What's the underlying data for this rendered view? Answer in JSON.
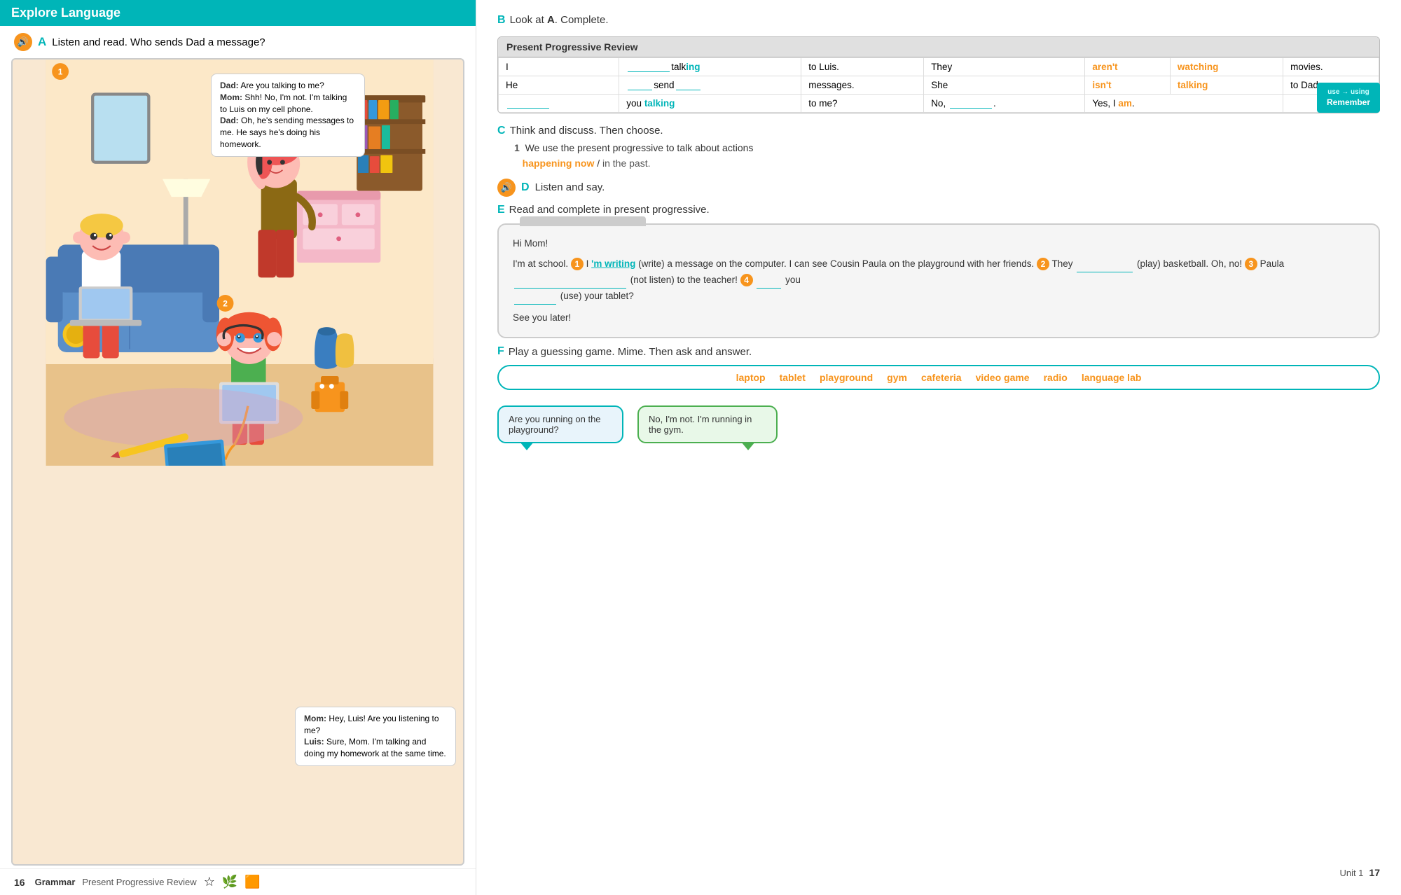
{
  "left": {
    "header": "Explore Language",
    "section_a": {
      "label": "A",
      "instruction": "Listen and read. Who sends Dad a message?"
    },
    "badge_1": "1",
    "badge_2": "2",
    "dialogues": [
      {
        "speaker": "Dad:",
        "text": "Are you talking to me?"
      },
      {
        "speaker": "Mom:",
        "text": "Shh! No, I'm not. I'm talking to Luis on my cell phone."
      },
      {
        "speaker": "Dad:",
        "text": "Oh, he's sending messages to me. He says he's doing his homework."
      }
    ],
    "dialogues2": [
      {
        "speaker": "Mom:",
        "text": "Hey, Luis! Are you listening to me?"
      },
      {
        "speaker": "Luis:",
        "text": "Sure, Mom. I'm talking and doing my homework at the same time."
      }
    ],
    "bottom": {
      "page_num": "16",
      "label": "Grammar",
      "sublabel": "Present Progressive Review",
      "icons": [
        "☆",
        "🌿",
        "⬛"
      ]
    }
  },
  "right": {
    "section_b": {
      "label": "B",
      "instruction": "Look at A. Complete."
    },
    "table": {
      "title": "Present Progressive Review",
      "rows": [
        {
          "col1": "I",
          "col2": "",
          "col2_suffix": "talk",
          "col2_highlight": "ing",
          "col3": "to Luis.",
          "col4": "They",
          "col5": "aren't",
          "col6": "watching",
          "col7": "movies."
        },
        {
          "col1": "He",
          "col2": "",
          "col2_suffix": "send",
          "col2_blank": true,
          "col3": "messages.",
          "col4": "She",
          "col5": "isn't",
          "col6": "talking",
          "col7": "to Dad."
        },
        {
          "col1": "",
          "col1_blank": true,
          "col2": "you",
          "col2_teal": "talking",
          "col3": "to me?",
          "col4": "No,",
          "col4_blank": true,
          "col5": ".",
          "col6": "Yes, I",
          "col6_highlight": "am",
          "col7": "."
        }
      ]
    },
    "section_c": {
      "label": "C",
      "instruction": "Think and discuss. Then choose.",
      "item_1": "We use the present progressive to talk about actions",
      "option_1": "happening now",
      "slash": "/",
      "option_2": "in the past."
    },
    "remember": {
      "use_arrow": "use → using",
      "label": "Remember"
    },
    "section_d": {
      "label": "D",
      "instruction": "Listen and say."
    },
    "section_e": {
      "label": "E",
      "instruction": "Read and complete in present progressive.",
      "email": {
        "greeting": "Hi Mom!",
        "line1": "I'm at school.",
        "num1": "1",
        "writing_part1": "I'm writing",
        "writing_part2": "(write) a message on the",
        "line2": "computer. I can see Cousin Paula on the playground with her",
        "line3": "friends.",
        "num2": "2",
        "blank2": "(play) basketball.  Oh, no!",
        "num3": "3",
        "word3": "Paula",
        "line4_blank": "(not listen) to the teacher!",
        "num4": "4",
        "blank4a": "you",
        "blank4b": "(use) your tablet?",
        "signoff": "See you later!"
      }
    },
    "section_f": {
      "label": "F",
      "instruction": "Play a guessing game. Mime. Then ask and answer.",
      "words": [
        "laptop",
        "tablet",
        "playground",
        "gym",
        "cafeteria",
        "video game",
        "radio",
        "language lab"
      ],
      "bubble_q": "Are you running on the playground?",
      "bubble_a": "No, I'm not. I'm running in the gym."
    },
    "bottom": {
      "unit_label": "Unit 1",
      "page_num": "17"
    }
  }
}
